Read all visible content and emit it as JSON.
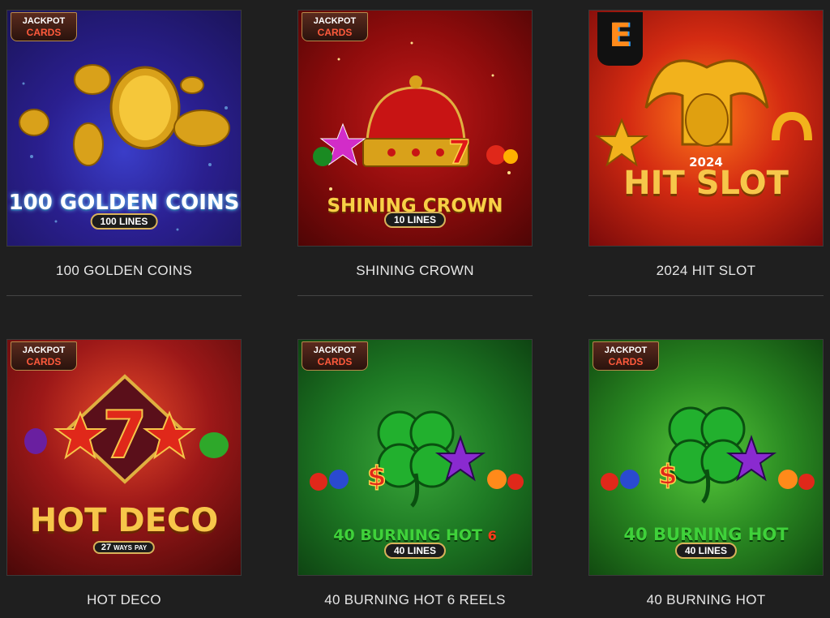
{
  "games": [
    {
      "title": "100 GOLDEN COINS",
      "badge_top": "JACKPOT",
      "badge_bottom": "CARDS",
      "art_title": "100 GOLDEN COINS",
      "art_sub": "100 LINES"
    },
    {
      "title": "SHINING CROWN",
      "badge_top": "JACKPOT",
      "badge_bottom": "CARDS",
      "art_title": "SHINING CROWN",
      "art_sub": "10 LINES"
    },
    {
      "title": "2024 HIT SLOT",
      "art_year": "2024",
      "art_title": "HIT SLOT",
      "provider_logo": "E"
    },
    {
      "title": "HOT DECO",
      "badge_top": "JACKPOT",
      "badge_bottom": "CARDS",
      "art_title": "HOT DECO",
      "art_num": "27",
      "art_ways": "WAYS",
      "art_pay": "PAY",
      "art_seven": "7"
    },
    {
      "title": "40 BURNING HOT 6 REELS",
      "badge_top": "JACKPOT",
      "badge_bottom": "CARDS",
      "art_title": "40 BURNING HOT",
      "art_six": "6",
      "art_sub": "40 LINES"
    },
    {
      "title": "40 BURNING HOT",
      "badge_top": "JACKPOT",
      "badge_bottom": "CARDS",
      "art_title": "40 BURNING HOT",
      "art_sub": "40 LINES"
    }
  ],
  "colors": {
    "background": "#1f1f1f",
    "title_text": "#e6e6e6",
    "divider": "#444444"
  }
}
